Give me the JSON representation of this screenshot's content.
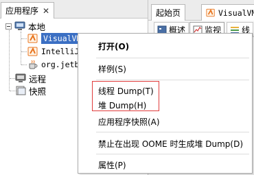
{
  "left_panel": {
    "tab_label": "应用程序",
    "tab_close": "✕",
    "tree": {
      "local": "本地",
      "apps": [
        "VisualVM",
        "IntelliJ",
        "org.jetbr"
      ],
      "remote": "远程",
      "snapshots": "快照"
    }
  },
  "right_panel": {
    "tabs": [
      "起始页",
      "VisualVM"
    ],
    "subtabs": [
      "概述",
      "监视",
      "线"
    ]
  },
  "context_menu": {
    "items": [
      {
        "label": "打开(O)"
      },
      {
        "label": "样例(S)"
      },
      {
        "label": "线程 Dump(T)"
      },
      {
        "label": "堆 Dump(H)"
      },
      {
        "label": "应用程序快照(A)"
      },
      {
        "label": "禁止在出现 OOME 时生成堆 Dump(D)"
      },
      {
        "label": "属性(P)"
      }
    ],
    "highlight_color": "#e03b3b"
  },
  "colors": {
    "selection": "#3b6fc3",
    "accent_orange": "#e8731e"
  }
}
